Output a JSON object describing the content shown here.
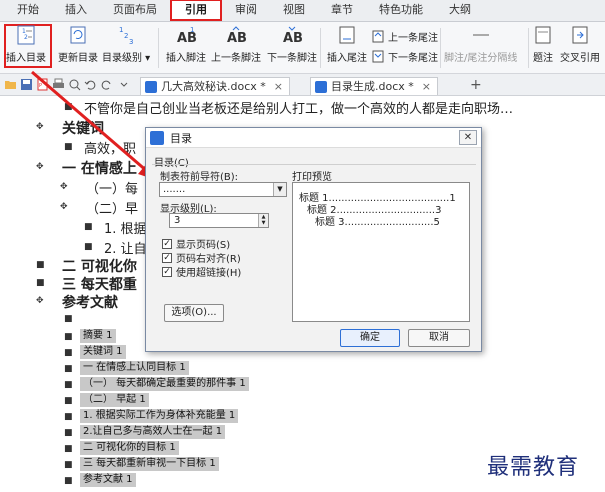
{
  "tabs": [
    "开始",
    "插入",
    "页面布局",
    "引用",
    "审阅",
    "视图",
    "章节",
    "特色功能",
    "大纲"
  ],
  "active_tab": "引用",
  "ribbon": {
    "insert_toc": "插入目录",
    "update_toc": "更新目录",
    "toc_level": "目录级别",
    "insert_footnote": "插入脚注",
    "prev_footnote": "上一条脚注",
    "next_footnote": "下一条脚注",
    "insert_endnote": "插入尾注",
    "prev_endnote": "上一条尾注",
    "next_endnote": "下一条尾注",
    "footnote_separator": "脚注/尾注分隔线",
    "caption": "题注",
    "cross_reference": "交叉引用"
  },
  "doc_tabs": [
    {
      "title": "几大高效秘诀.docx *",
      "close": "×"
    },
    {
      "title": "目录生成.docx *",
      "close": "×"
    }
  ],
  "doc": {
    "intro": "不管你是自己创业当老板还是给别人打工，做一个高效的人都是走向职场…",
    "keywords_heading": "关键词",
    "keywords_text": "高效，职",
    "s1": "一 在情感上",
    "s1a": "（一）每",
    "s1b": "（二）早",
    "s1b1": "1. 根据",
    "s1b2": "2. 让自",
    "s2": "二 可视化你",
    "s3": "三 每天都重",
    "refs": "参考文献"
  },
  "toc_lines": [
    "摘要    1",
    "关键词    1",
    "一 在情感上认同目标    1",
    "（一） 每天都确定最重要的那件事    1",
    "（二） 早起    1",
    "1. 根据实际工作为身体补充能量    1",
    "2.让自己多与高效人士在一起    1",
    "二 可视化你的目标    1",
    "三 每天都重新审视一下目标    1",
    "参考文献    1"
  ],
  "dialog": {
    "title": "目录",
    "close": "✕",
    "group_label": "目录(C)",
    "leader_label": "制表符前导符(B):",
    "leader_value": ".......",
    "level_label": "显示级别(L):",
    "level_value": "3",
    "show_page_numbers": "显示页码(S)",
    "right_align": "页码右对齐(R)",
    "use_hyperlinks": "使用超链接(H)",
    "preview_label": "打印预览",
    "preview_lines": [
      "标题 1......................................1",
      "标题 2...............................3",
      "标题 3............................5"
    ],
    "options_button": "选项(O)...",
    "ok_button": "确定",
    "cancel_button": "取消"
  },
  "watermark": "最需教育",
  "colors": {
    "highlight": "#e02020",
    "accent": "#2d6fd6"
  }
}
